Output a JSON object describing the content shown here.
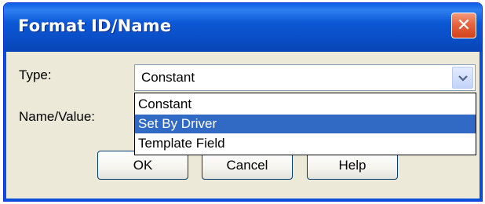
{
  "window": {
    "title": "Format ID/Name",
    "close_label": "✕"
  },
  "form": {
    "type_label": "Type:",
    "name_value_label": "Name/Value:"
  },
  "type_select": {
    "selected_value": "Constant",
    "arrow_icon": "chevron-down-icon",
    "options": [
      {
        "label": "Constant",
        "highlighted": false
      },
      {
        "label": "Set By Driver",
        "highlighted": true
      },
      {
        "label": "Template Field",
        "highlighted": false
      }
    ]
  },
  "buttons": {
    "ok": "OK",
    "cancel": "Cancel",
    "help": "Help"
  },
  "colors": {
    "title_bar": "#0a4fc7",
    "dialog_background": "#ece9d8",
    "selection_highlight": "#316ac5",
    "close_button": "#e5643e"
  }
}
